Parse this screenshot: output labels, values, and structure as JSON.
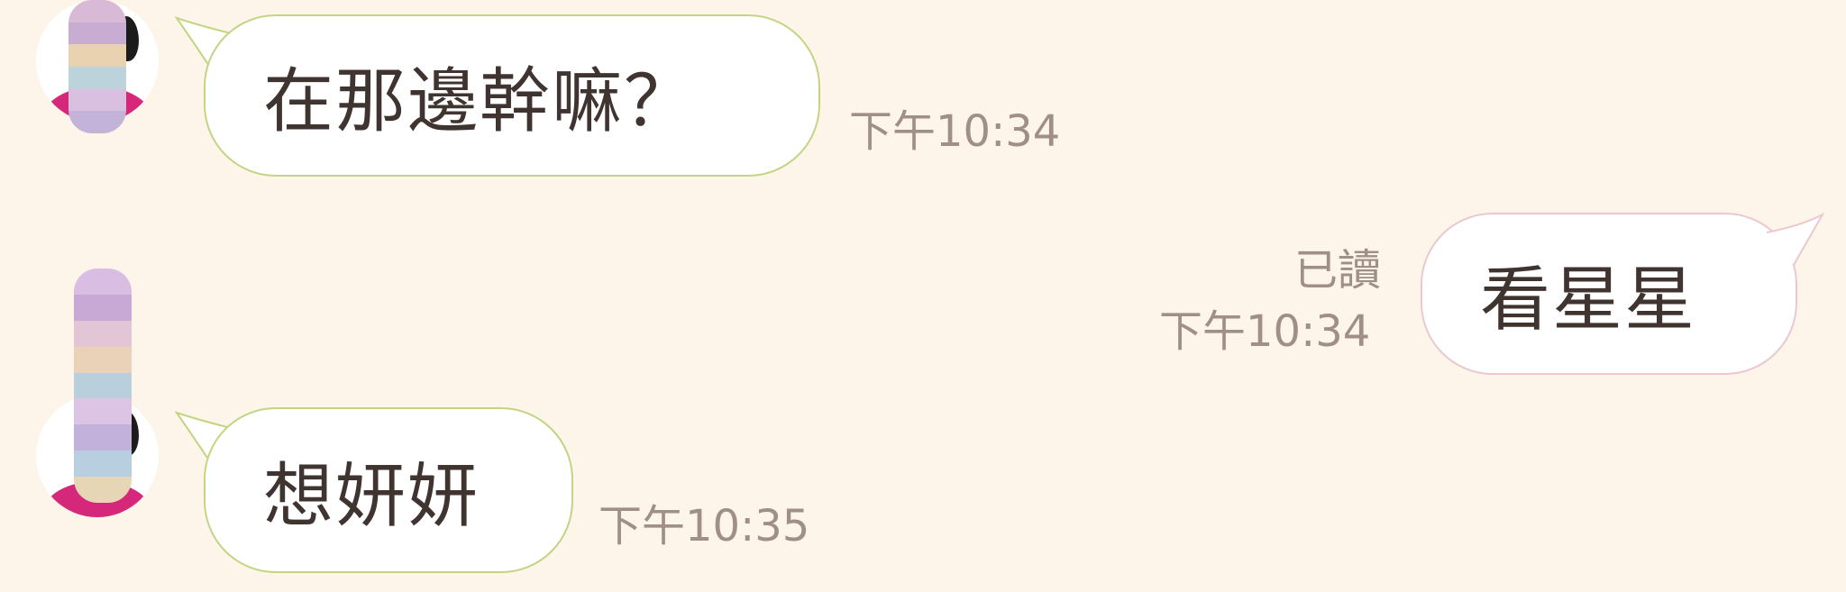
{
  "messages": [
    {
      "direction": "incoming",
      "text": "在那邊幹嘛？",
      "time": "下午10:34"
    },
    {
      "direction": "outgoing",
      "text": "看星星",
      "time": "下午10:34",
      "status": "已讀"
    },
    {
      "direction": "incoming",
      "text": "想妍妍",
      "time": "下午10:35"
    }
  ],
  "colors": {
    "background": "#fdf5ea",
    "incoming_border": "#c3d584",
    "outgoing_border": "#ebc8d0",
    "meta_text": "#a08f86"
  }
}
